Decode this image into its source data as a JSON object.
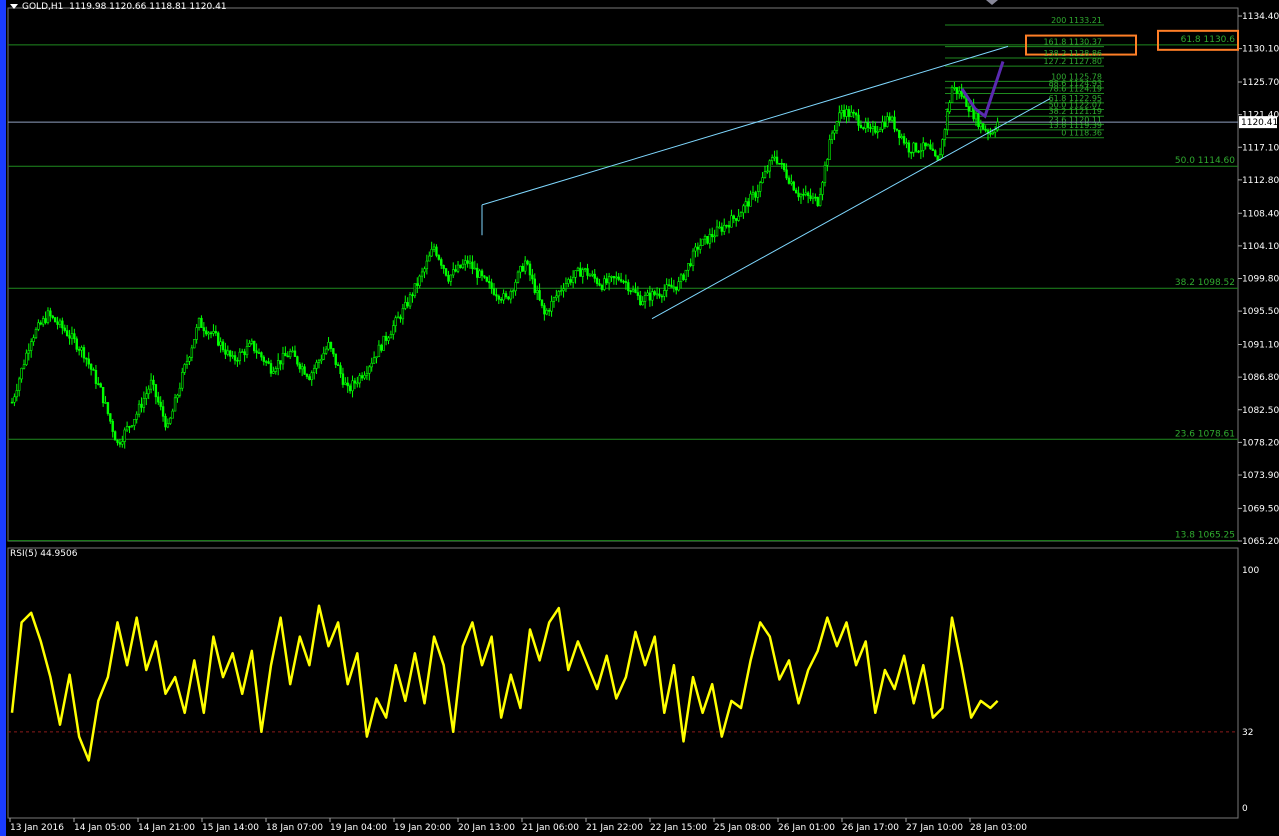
{
  "header": {
    "symbol": "GOLD,H1",
    "ohlc": "1119.98 1120.66 1118.81 1120.41"
  },
  "rsi": {
    "label": "RSI(5) 44.9506",
    "scale_labels": [
      "100",
      "32",
      "0"
    ],
    "level": 32
  },
  "price_axis": {
    "labels": [
      "1134.40",
      "1130.10",
      "1125.70",
      "1121.40",
      "1117.10",
      "1112.80",
      "1108.40",
      "1104.10",
      "1099.80",
      "1095.50",
      "1091.10",
      "1086.80",
      "1082.50",
      "1078.20",
      "1073.90",
      "1069.50",
      "1065.20"
    ],
    "current_price": "1120.41"
  },
  "time_axis": {
    "labels": [
      "13 Jan 2016",
      "14 Jan 05:00",
      "14 Jan 21:00",
      "15 Jan 14:00",
      "18 Jan 07:00",
      "19 Jan 04:00",
      "19 Jan 20:00",
      "20 Jan 13:00",
      "21 Jan 06:00",
      "21 Jan 22:00",
      "22 Jan 15:00",
      "25 Jan 08:00",
      "26 Jan 01:00",
      "26 Jan 17:00",
      "27 Jan 10:00",
      "28 Jan 03:00"
    ]
  },
  "fib_main": [
    {
      "label": "61.8 1130.6",
      "price": 1130.6,
      "boxed": true
    },
    {
      "label": "50.0 1114.60",
      "price": 1114.6,
      "boxed": false
    },
    {
      "label": "38.2 1098.52",
      "price": 1098.52,
      "boxed": false
    },
    {
      "label": "23.6 1078.61",
      "price": 1078.61,
      "boxed": false
    },
    {
      "label": "13.8 1065.25",
      "price": 1065.25,
      "boxed": false
    }
  ],
  "fib_ext": [
    {
      "label": "200 1133.21",
      "price": 1133.21,
      "boxed": false
    },
    {
      "label": "161.8 1130.37",
      "price": 1130.37,
      "boxed": true
    },
    {
      "label": "138.2 1128.86",
      "price": 1128.86,
      "boxed": false
    },
    {
      "label": "127.2 1127.80",
      "price": 1127.8,
      "boxed": false
    },
    {
      "label": "100 1125.78",
      "price": 1125.78,
      "boxed": false
    },
    {
      "label": "88.6 1124.93",
      "price": 1124.93,
      "boxed": false
    },
    {
      "label": "78.6 1124.19",
      "price": 1124.19,
      "boxed": false
    },
    {
      "label": "61.8 1122.95",
      "price": 1122.95,
      "boxed": false
    },
    {
      "label": "50.0 1122.07",
      "price": 1122.07,
      "boxed": false
    },
    {
      "label": "38.2 1121.19",
      "price": 1121.19,
      "boxed": false
    },
    {
      "label": "23.6 1120.11",
      "price": 1120.11,
      "boxed": false
    },
    {
      "label": "13.8 1119.39",
      "price": 1119.39,
      "boxed": false
    },
    {
      "label": "0 1118.36",
      "price": 1118.36,
      "boxed": false
    }
  ],
  "colors": {
    "candle": "#00ff00",
    "fib": "#1f8a1f",
    "fib_text": "#2faa2f",
    "channel": "#7fd8ff",
    "rsi": "#ffff00",
    "highlight": "#ff7f27",
    "pattern": "#5a2ab0",
    "axis_text": "#ffffff",
    "rsi_level": "#8b1a1a"
  },
  "chart_data": {
    "type": "candlestick",
    "ylim": [
      1065.2,
      1136.0
    ],
    "close_path": [
      [
        0,
        1083.5
      ],
      [
        8,
        1092
      ],
      [
        15,
        1095
      ],
      [
        22,
        1093
      ],
      [
        30,
        1090
      ],
      [
        37,
        1085
      ],
      [
        44,
        1078
      ],
      [
        52,
        1082
      ],
      [
        58,
        1086
      ],
      [
        65,
        1080
      ],
      [
        72,
        1088
      ],
      [
        78,
        1094
      ],
      [
        85,
        1092
      ],
      [
        92,
        1089
      ],
      [
        100,
        1091
      ],
      [
        108,
        1088
      ],
      [
        116,
        1090
      ],
      [
        124,
        1087
      ],
      [
        132,
        1091
      ],
      [
        140,
        1085
      ],
      [
        148,
        1088
      ],
      [
        156,
        1092
      ],
      [
        164,
        1096
      ],
      [
        172,
        1101
      ],
      [
        176,
        1104
      ],
      [
        182,
        1100
      ],
      [
        190,
        1102
      ],
      [
        198,
        1099
      ],
      [
        206,
        1097
      ],
      [
        214,
        1102
      ],
      [
        222,
        1095
      ],
      [
        230,
        1099
      ],
      [
        238,
        1101
      ],
      [
        246,
        1099
      ],
      [
        254,
        1100
      ],
      [
        262,
        1097
      ],
      [
        270,
        1098
      ],
      [
        278,
        1099
      ],
      [
        286,
        1104
      ],
      [
        294,
        1106
      ],
      [
        302,
        1108
      ],
      [
        310,
        1111
      ],
      [
        318,
        1116
      ],
      [
        322,
        1114
      ],
      [
        328,
        1111
      ],
      [
        336,
        1110
      ],
      [
        342,
        1119
      ],
      [
        346,
        1122
      ],
      [
        352,
        1121
      ],
      [
        358,
        1119
      ],
      [
        366,
        1121
      ],
      [
        374,
        1117
      ],
      [
        382,
        1117
      ],
      [
        386,
        1115
      ],
      [
        388,
        1118
      ],
      [
        392,
        1125
      ],
      [
        396,
        1124
      ],
      [
        400,
        1122
      ],
      [
        404,
        1120
      ],
      [
        408,
        1119
      ],
      [
        411,
        1120.4
      ]
    ],
    "rsi": [
      [
        0,
        40
      ],
      [
        4,
        78
      ],
      [
        8,
        82
      ],
      [
        12,
        70
      ],
      [
        16,
        55
      ],
      [
        20,
        35
      ],
      [
        24,
        56
      ],
      [
        28,
        30
      ],
      [
        32,
        20
      ],
      [
        36,
        45
      ],
      [
        40,
        55
      ],
      [
        44,
        78
      ],
      [
        48,
        60
      ],
      [
        52,
        80
      ],
      [
        56,
        58
      ],
      [
        60,
        70
      ],
      [
        64,
        48
      ],
      [
        68,
        55
      ],
      [
        72,
        40
      ],
      [
        76,
        62
      ],
      [
        80,
        40
      ],
      [
        84,
        72
      ],
      [
        88,
        55
      ],
      [
        92,
        65
      ],
      [
        96,
        48
      ],
      [
        100,
        66
      ],
      [
        104,
        32
      ],
      [
        108,
        60
      ],
      [
        112,
        80
      ],
      [
        116,
        52
      ],
      [
        120,
        72
      ],
      [
        124,
        60
      ],
      [
        128,
        85
      ],
      [
        132,
        68
      ],
      [
        136,
        78
      ],
      [
        140,
        52
      ],
      [
        144,
        65
      ],
      [
        148,
        30
      ],
      [
        152,
        46
      ],
      [
        156,
        38
      ],
      [
        160,
        60
      ],
      [
        164,
        45
      ],
      [
        168,
        65
      ],
      [
        172,
        44
      ],
      [
        176,
        72
      ],
      [
        180,
        60
      ],
      [
        184,
        32
      ],
      [
        188,
        68
      ],
      [
        192,
        78
      ],
      [
        196,
        60
      ],
      [
        200,
        72
      ],
      [
        204,
        38
      ],
      [
        208,
        56
      ],
      [
        212,
        42
      ],
      [
        216,
        75
      ],
      [
        220,
        62
      ],
      [
        224,
        78
      ],
      [
        228,
        84
      ],
      [
        232,
        58
      ],
      [
        236,
        70
      ],
      [
        240,
        60
      ],
      [
        244,
        50
      ],
      [
        248,
        64
      ],
      [
        252,
        46
      ],
      [
        256,
        55
      ],
      [
        260,
        74
      ],
      [
        264,
        60
      ],
      [
        268,
        72
      ],
      [
        272,
        40
      ],
      [
        276,
        60
      ],
      [
        280,
        28
      ],
      [
        284,
        55
      ],
      [
        288,
        40
      ],
      [
        292,
        52
      ],
      [
        296,
        30
      ],
      [
        300,
        45
      ],
      [
        304,
        42
      ],
      [
        308,
        62
      ],
      [
        312,
        78
      ],
      [
        316,
        72
      ],
      [
        320,
        54
      ],
      [
        324,
        62
      ],
      [
        328,
        44
      ],
      [
        332,
        58
      ],
      [
        336,
        66
      ],
      [
        340,
        80
      ],
      [
        344,
        68
      ],
      [
        348,
        78
      ],
      [
        352,
        60
      ],
      [
        356,
        70
      ],
      [
        360,
        40
      ],
      [
        364,
        58
      ],
      [
        368,
        50
      ],
      [
        372,
        64
      ],
      [
        376,
        44
      ],
      [
        380,
        60
      ],
      [
        384,
        38
      ],
      [
        388,
        42
      ],
      [
        392,
        80
      ],
      [
        396,
        60
      ],
      [
        400,
        38
      ],
      [
        404,
        45
      ],
      [
        408,
        42
      ],
      [
        411,
        45
      ]
    ]
  }
}
